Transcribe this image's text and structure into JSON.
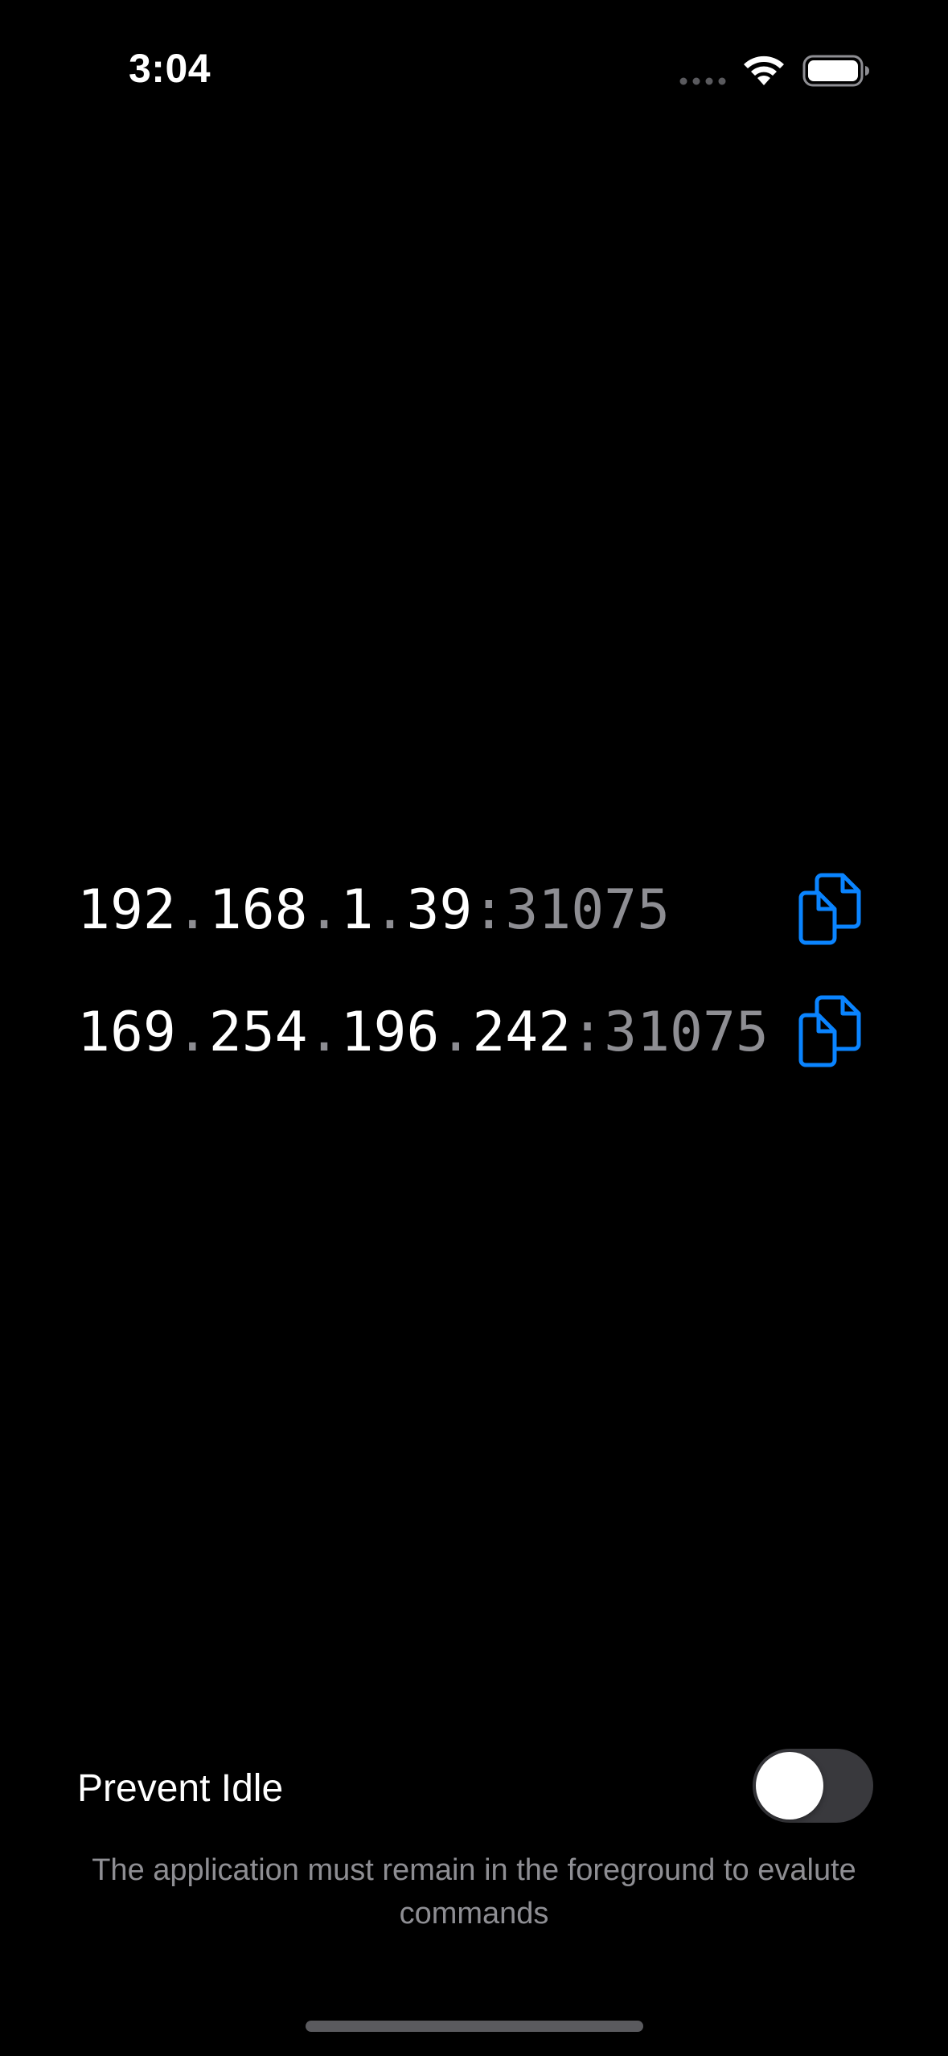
{
  "status_bar": {
    "time": "3:04"
  },
  "addresses": [
    {
      "octets": [
        "192",
        "168",
        "1",
        "39"
      ],
      "port": "31075"
    },
    {
      "octets": [
        "169",
        "254",
        "196",
        "242"
      ],
      "port": "31075"
    }
  ],
  "settings": {
    "prevent_idle_label": "Prevent Idle",
    "prevent_idle_enabled": false,
    "note": "The application must remain in the foreground to evalute commands"
  },
  "colors": {
    "background": "#000000",
    "accent": "#0a84ff",
    "secondary_text": "#8e8e93"
  }
}
